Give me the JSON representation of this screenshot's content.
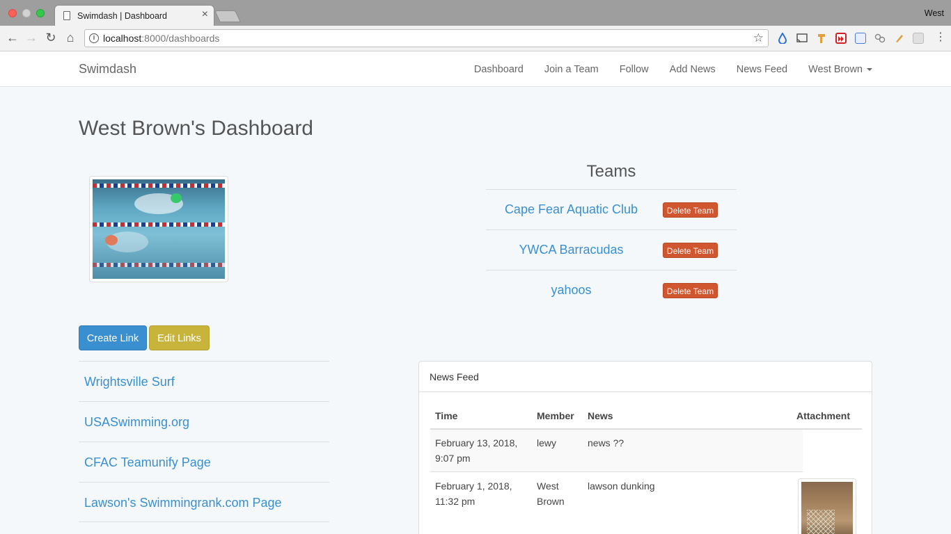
{
  "browser": {
    "tab_title": "Swimdash | Dashboard",
    "tab_close": "×",
    "profile_name": "West",
    "url_host": "localhost",
    "url_rest": ":8000/dashboards",
    "icons": [
      "back-arrow-icon",
      "forward-arrow-icon",
      "reload-icon",
      "home-icon",
      "info-icon",
      "star-icon"
    ]
  },
  "navbar": {
    "brand": "Swimdash",
    "links": [
      "Dashboard",
      "Join a Team",
      "Follow",
      "Add News",
      "News Feed",
      "West Brown"
    ]
  },
  "page": {
    "title": "West Brown's Dashboard"
  },
  "teams": {
    "heading": "Teams",
    "delete_label": "Delete Team",
    "items": [
      "Cape Fear Aquatic Club",
      "YWCA Barracudas",
      "yahoos"
    ]
  },
  "links": {
    "create_label": "Create Link",
    "edit_label": "Edit Links",
    "items": [
      "Wrightsville Surf",
      "USASwimming.org",
      "CFAC Teamunify Page",
      "Lawson's Swimmingrank.com Page"
    ]
  },
  "news_feed": {
    "heading": "News Feed",
    "columns": [
      "Time",
      "Member",
      "News",
      "Attachment"
    ],
    "rows": [
      {
        "time_l1": "February 13, 2018,",
        "time_l2": "9:07 pm",
        "member_l1": "lewy",
        "member_l2": "",
        "news": "news ??"
      },
      {
        "time_l1": "February 1, 2018,",
        "time_l2": "11:32 pm",
        "member_l1": "West",
        "member_l2": "Brown",
        "news": "lawson dunking"
      }
    ]
  },
  "colors": {
    "link_blue": "#3a8fd0",
    "delete_red": "#d0562f",
    "edit_yellow": "#c8b43a",
    "page_bg": "#f4f8fb"
  }
}
